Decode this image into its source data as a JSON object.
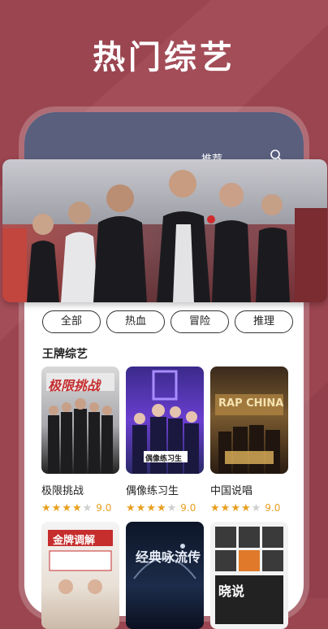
{
  "headline": "热门综艺",
  "phone": {
    "tabs": [
      {
        "label": "推荐"
      }
    ],
    "search_icon": "search-icon"
  },
  "banner": {
    "alt": "variety show cast poster"
  },
  "filters": [
    "全部",
    "热血",
    "冒险",
    "推理"
  ],
  "section_title": "王牌综艺",
  "shows": [
    {
      "title": "极限挑战",
      "rating": "9.0",
      "stars": 4,
      "poster_text": "极限挑战"
    },
    {
      "title": "偶像练习生",
      "rating": "9.0",
      "stars": 4,
      "poster_text": "偶像练习生"
    },
    {
      "title": "中国说唱",
      "rating": "9.0",
      "stars": 4,
      "poster_text": "RAP CHINA"
    },
    {
      "title": "",
      "rating": "",
      "stars": 0,
      "poster_text": "金牌调解"
    },
    {
      "title": "",
      "rating": "",
      "stars": 0,
      "poster_text": "经典咏流传"
    },
    {
      "title": "",
      "rating": "",
      "stars": 0,
      "poster_text": "晓说"
    }
  ],
  "colors": {
    "background": "#9b4550",
    "phone_header": "#5a5f7e",
    "star": "#e8a020"
  }
}
